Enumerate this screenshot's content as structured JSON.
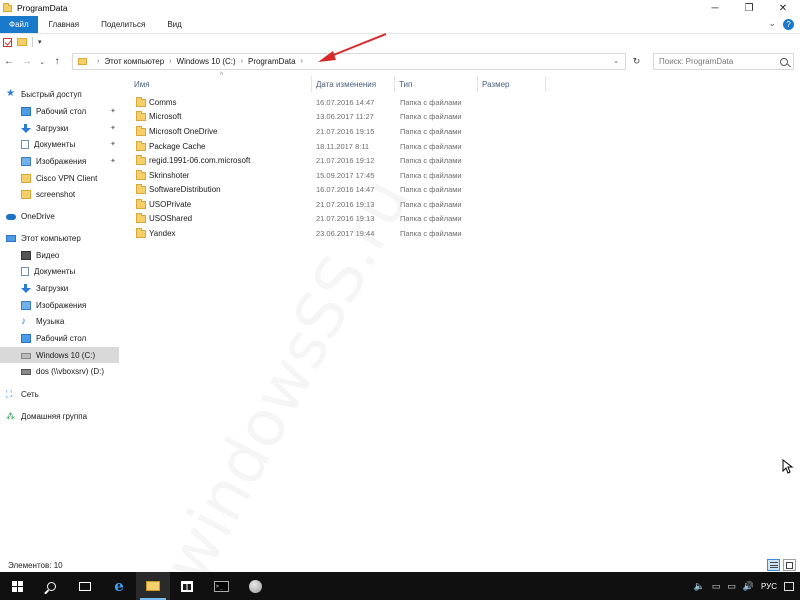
{
  "window": {
    "title": "ProgramData",
    "controls": [
      "─",
      "❐",
      "✕"
    ]
  },
  "ribbon": {
    "tabs": [
      "Файл",
      "Главная",
      "Поделиться",
      "Вид"
    ],
    "collapse_glyph": "⌄",
    "help_glyph": "?"
  },
  "qat": {
    "dropdown_glyph": "▾"
  },
  "nav": {
    "back": "←",
    "forward": "→",
    "recent": "⌄",
    "up": "↑",
    "breadcrumbs": [
      "Этот компьютер",
      "Windows 10 (C:)",
      "ProgramData"
    ],
    "crumb_sep": "›",
    "drop": "⌄",
    "refresh": "↻",
    "search_placeholder": "Поиск: ProgramData"
  },
  "sidebar": {
    "items": [
      {
        "label": "Быстрый доступ",
        "icon": "star-icon",
        "pinned": false
      },
      {
        "label": "Рабочий стол",
        "icon": "desktop-icon",
        "pinned": true
      },
      {
        "label": "Загрузки",
        "icon": "downloads-icon",
        "pinned": true
      },
      {
        "label": "Документы",
        "icon": "documents-icon",
        "pinned": true
      },
      {
        "label": "Изображения",
        "icon": "pictures-icon",
        "pinned": true
      },
      {
        "label": "Cisco VPN Client",
        "icon": "folder-icon",
        "pinned": false
      },
      {
        "label": "screenshot",
        "icon": "folder-icon",
        "pinned": false
      },
      {
        "label": "OneDrive",
        "icon": "onedrive-icon",
        "pinned": false
      },
      {
        "label": "Этот компьютер",
        "icon": "computer-icon",
        "pinned": false
      },
      {
        "label": "Видео",
        "icon": "video-icon",
        "pinned": false
      },
      {
        "label": "Документы",
        "icon": "documents-icon",
        "pinned": false
      },
      {
        "label": "Загрузки",
        "icon": "downloads-icon",
        "pinned": false
      },
      {
        "label": "Изображения",
        "icon": "pictures-icon",
        "pinned": false
      },
      {
        "label": "Музыка",
        "icon": "music-icon",
        "pinned": false
      },
      {
        "label": "Рабочий стол",
        "icon": "desktop-icon",
        "pinned": false
      },
      {
        "label": "Windows 10 (C:)",
        "icon": "drive-icon",
        "pinned": false,
        "selected": true
      },
      {
        "label": "dos (\\\\vboxsrv) (D:)",
        "icon": "network-drive-icon",
        "pinned": false
      },
      {
        "label": "Сеть",
        "icon": "network-icon",
        "pinned": false
      },
      {
        "label": "Домашняя группа",
        "icon": "homegroup-icon",
        "pinned": false
      }
    ],
    "pin_glyph": "✦"
  },
  "columns": {
    "name": "Имя",
    "date": "Дата изменения",
    "type": "Тип",
    "size": "Размер",
    "sort_glyph": "^"
  },
  "files": [
    {
      "name": "Comms",
      "date": "16.07.2016 14:47",
      "type": "Папка с файлами"
    },
    {
      "name": "Microsoft",
      "date": "13.06.2017 11:27",
      "type": "Папка с файлами"
    },
    {
      "name": "Microsoft OneDrive",
      "date": "21.07.2016 19:15",
      "type": "Папка с файлами"
    },
    {
      "name": "Package Cache",
      "date": "18.11.2017 8:11",
      "type": "Папка с файлами"
    },
    {
      "name": "regid.1991-06.com.microsoft",
      "date": "21.07.2016 19:12",
      "type": "Папка с файлами"
    },
    {
      "name": "Skrinshoter",
      "date": "15.09.2017 17:45",
      "type": "Папка с файлами"
    },
    {
      "name": "SoftwareDistribution",
      "date": "16.07.2016 14:47",
      "type": "Папка с файлами"
    },
    {
      "name": "USOPrivate",
      "date": "21.07.2016 19:13",
      "type": "Папка с файлами"
    },
    {
      "name": "USOShared",
      "date": "21.07.2016 19:13",
      "type": "Папка с файлами"
    },
    {
      "name": "Yandex",
      "date": "23.06.2017 19:44",
      "type": "Папка с файлами"
    }
  ],
  "watermark": "windowsSS.ru",
  "status": {
    "items_count": "Элементов: 10"
  },
  "taskbar": {
    "cmd_text": ">_"
  },
  "tray": {
    "icons": [
      "🔈",
      "▭",
      "▭",
      "🔊"
    ],
    "lang": "РУС"
  },
  "colors": {
    "file_tab": "#1979ca",
    "annotation_arrow": "#d62b2b",
    "selection": "#d9d9d9",
    "taskbar": "#101010"
  }
}
